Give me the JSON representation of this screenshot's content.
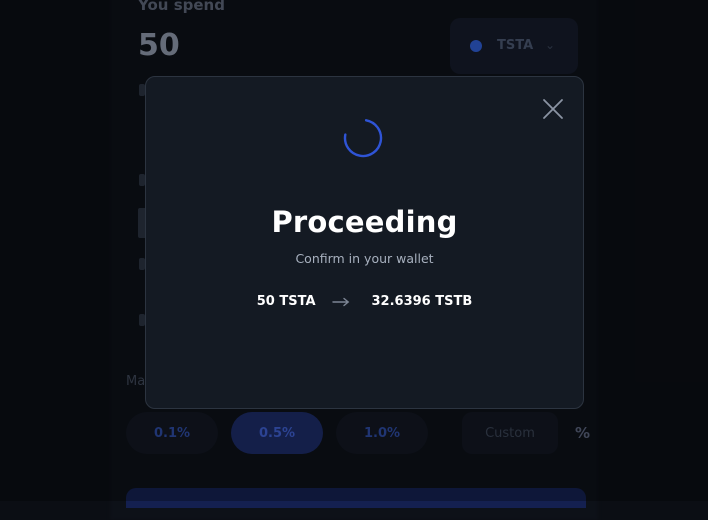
{
  "background": {
    "spend_label": "You spend",
    "spend_amount": "50",
    "token_symbol": "TSTA",
    "slippage_options": [
      "0.1%",
      "0.5%",
      "1.0%"
    ],
    "slippage_selected": "0.5%",
    "custom_placeholder": "Custom",
    "percent_sign": "%"
  },
  "modal": {
    "title": "Proceeding",
    "subtitle": "Confirm in your wallet",
    "from_amount": "50 TSTA",
    "to_amount": "32.6396 TSTB"
  },
  "colors": {
    "accent": "#2f54d6",
    "modal_bg": "#141a23",
    "page_bg": "#0b0e14"
  },
  "icons": [
    "close-icon",
    "spinner-icon",
    "arrow-right-icon",
    "token-icon",
    "chevron-down-icon"
  ]
}
